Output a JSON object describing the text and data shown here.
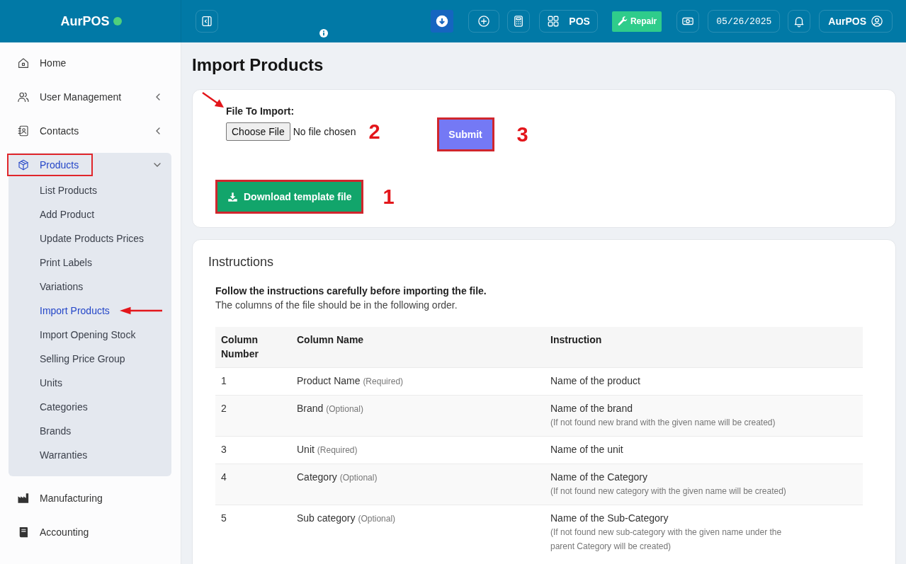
{
  "topbar": {
    "brand": "AurPOS",
    "pos_label": "POS",
    "repair_label": "Repair",
    "date": "05/26/2025",
    "user": "AurPOS"
  },
  "sidebar": {
    "items": [
      {
        "label": "Home",
        "kind": "link",
        "selected": false,
        "highlighted": false
      },
      {
        "label": "User Management",
        "kind": "menu",
        "expanded": false,
        "selected": false,
        "highlighted": false
      },
      {
        "label": "Contacts",
        "kind": "menu",
        "expanded": false,
        "selected": false,
        "highlighted": false
      },
      {
        "label": "Products",
        "kind": "menu",
        "expanded": true,
        "selected": true,
        "highlighted": true,
        "children": [
          {
            "label": "List Products",
            "selected": false,
            "arrow": false
          },
          {
            "label": "Add Product",
            "selected": false,
            "arrow": false
          },
          {
            "label": "Update Products Prices",
            "selected": false,
            "arrow": false
          },
          {
            "label": "Print Labels",
            "selected": false,
            "arrow": false
          },
          {
            "label": "Variations",
            "selected": false,
            "arrow": false
          },
          {
            "label": "Import Products",
            "selected": true,
            "arrow": true
          },
          {
            "label": "Import Opening Stock",
            "selected": false,
            "arrow": false
          },
          {
            "label": "Selling Price Group",
            "selected": false,
            "arrow": false
          },
          {
            "label": "Units",
            "selected": false,
            "arrow": false
          },
          {
            "label": "Categories",
            "selected": false,
            "arrow": false
          },
          {
            "label": "Brands",
            "selected": false,
            "arrow": false
          },
          {
            "label": "Warranties",
            "selected": false,
            "arrow": false
          }
        ]
      },
      {
        "label": "Manufacturing",
        "kind": "link",
        "selected": false,
        "highlighted": false
      },
      {
        "label": "Accounting",
        "kind": "link",
        "selected": false,
        "highlighted": false
      }
    ]
  },
  "page_title": "Import Products",
  "import_form": {
    "file_label": "File To Import:",
    "file_label_arrow": true,
    "file_button": "Choose File",
    "file_status": "No file chosen",
    "file_number": "2",
    "submit": {
      "label": "Submit",
      "highlighted": true,
      "number": "3"
    },
    "download": {
      "label": "Download template file",
      "highlighted": true,
      "number": "1"
    }
  },
  "instructions": {
    "title": "Instructions",
    "lead": "Follow the instructions carefully before importing the file.",
    "subtext": "The columns of the file should be in the following order.",
    "table": {
      "columns": [
        "Column Number",
        "Column Name",
        "Instruction"
      ],
      "rows": [
        {
          "number": "1",
          "name": "Product Name",
          "qualifier": "(Required)",
          "instruction": "Name of the product"
        },
        {
          "number": "2",
          "name": "Brand",
          "qualifier": "(Optional)",
          "instruction": "Name of the brand",
          "note": "(If not found new brand with the given name will be created)"
        },
        {
          "number": "3",
          "name": "Unit",
          "qualifier": "(Required)",
          "instruction": "Name of the unit"
        },
        {
          "number": "4",
          "name": "Category",
          "qualifier": "(Optional)",
          "instruction": "Name of the Category",
          "note": "(If not found new category with the given name will be created)"
        },
        {
          "number": "5",
          "name": "Sub category",
          "qualifier": "(Optional)",
          "instruction": "Name of the Sub-Category",
          "note": "(If not found new sub-category with the given name under the parent Category will be created)"
        }
      ]
    }
  }
}
